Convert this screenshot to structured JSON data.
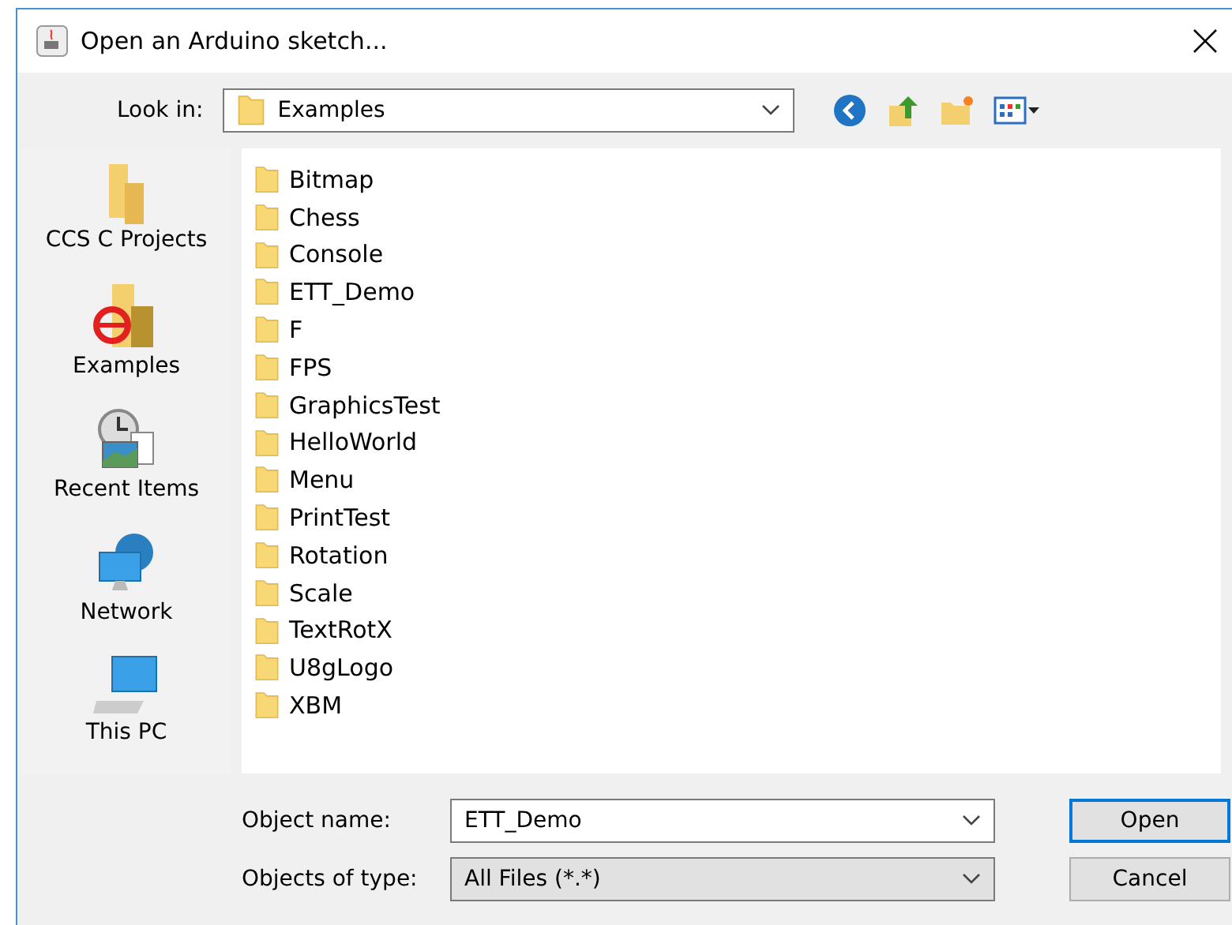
{
  "window": {
    "title": "Open an Arduino sketch..."
  },
  "look_in": {
    "label": "Look in:",
    "value": "Examples"
  },
  "sidebar": {
    "items": [
      {
        "label": "CCS C Projects",
        "kind": "folder"
      },
      {
        "label": "Examples",
        "kind": "app-folder"
      },
      {
        "label": "Recent Items",
        "kind": "recent"
      },
      {
        "label": "Network",
        "kind": "network"
      },
      {
        "label": "This PC",
        "kind": "computer"
      }
    ]
  },
  "files": [
    "Bitmap",
    "Chess",
    "Console",
    "ETT_Demo",
    "F",
    "FPS",
    "GraphicsTest",
    "HelloWorld",
    "Menu",
    "PrintTest",
    "Rotation",
    "Scale",
    "TextRotX",
    "U8gLogo",
    "XBM"
  ],
  "object_name": {
    "label": "Object name:",
    "value": "ETT_Demo"
  },
  "object_type": {
    "label": "Objects of type:",
    "value": "All Files (*.*)"
  },
  "buttons": [
    {
      "label": "Open",
      "default": true
    },
    {
      "label": "Cancel",
      "default": false
    }
  ]
}
